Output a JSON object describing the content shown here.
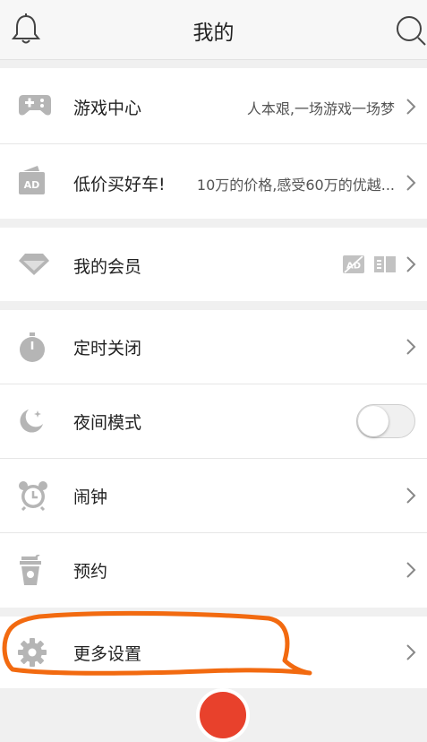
{
  "header": {
    "title": "我的"
  },
  "rows": {
    "game_center": {
      "label": "游戏中心",
      "sub": "人本艰,一场游戏一场梦"
    },
    "cheap_car": {
      "label": "低价买好车!",
      "sub": "10万的价格,感受60万的优越..."
    },
    "membership": {
      "label": "我的会员"
    },
    "timer_off": {
      "label": "定时关闭"
    },
    "night_mode": {
      "label": "夜间模式",
      "enabled": false
    },
    "alarm": {
      "label": "闹钟"
    },
    "reservation": {
      "label": "预约"
    },
    "more_settings": {
      "label": "更多设置"
    }
  },
  "colors": {
    "icon_gray": "#b5b5b5",
    "annotation": "#f26a10",
    "accent_red": "#e8412c"
  }
}
